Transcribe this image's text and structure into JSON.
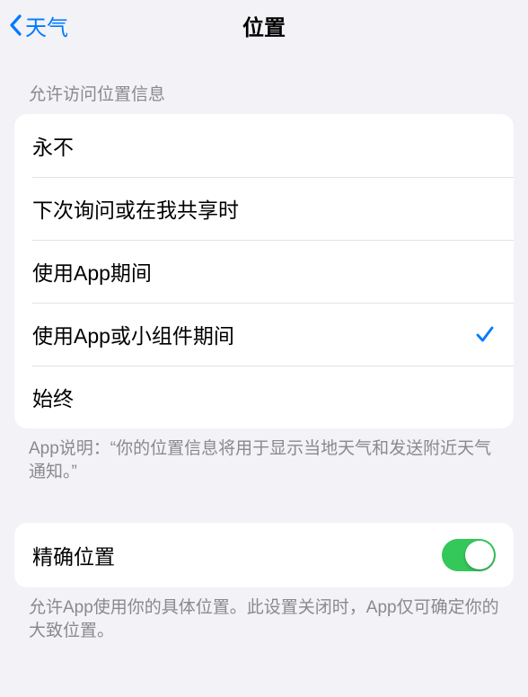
{
  "header": {
    "back_label": "天气",
    "title": "位置"
  },
  "access_section": {
    "header": "允许访问位置信息",
    "options": {
      "never": "永不",
      "ask": "下次询问或在我共享时",
      "while_using": "使用App期间",
      "while_using_widgets": "使用App或小组件期间",
      "always": "始终"
    },
    "selected": "while_using_widgets",
    "footer": "App说明：“你的位置信息将用于显示当地天气和发送附近天气通知。”"
  },
  "precise_section": {
    "label": "精确位置",
    "enabled": true,
    "footer": "允许App使用你的具体位置。此设置关闭时，App仅可确定你的大致位置。"
  }
}
